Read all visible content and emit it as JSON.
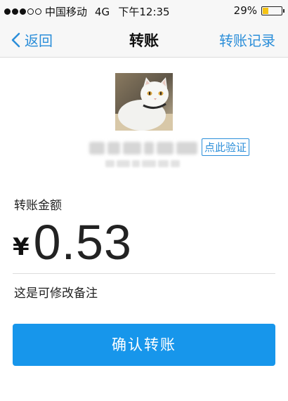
{
  "status_bar": {
    "carrier": "中国移动",
    "network": "4G",
    "time": "下午12:35",
    "battery_percent": "29%",
    "battery_level": 0.29,
    "battery_color": "#f5c314",
    "signal_strength": 3,
    "signal_max": 5
  },
  "nav": {
    "back_label": "返回",
    "title": "转账",
    "right_action": "转账记录",
    "accent_color": "#2b8ed9"
  },
  "recipient": {
    "avatar_icon": "white-cat-photo",
    "verify_label": "点此验证"
  },
  "transfer": {
    "amount_label": "转账金额",
    "currency_symbol": "¥",
    "amount": "0.53",
    "remark": "这是可修改备注"
  },
  "actions": {
    "confirm_label": "确认转账",
    "confirm_color": "#1796eb"
  }
}
